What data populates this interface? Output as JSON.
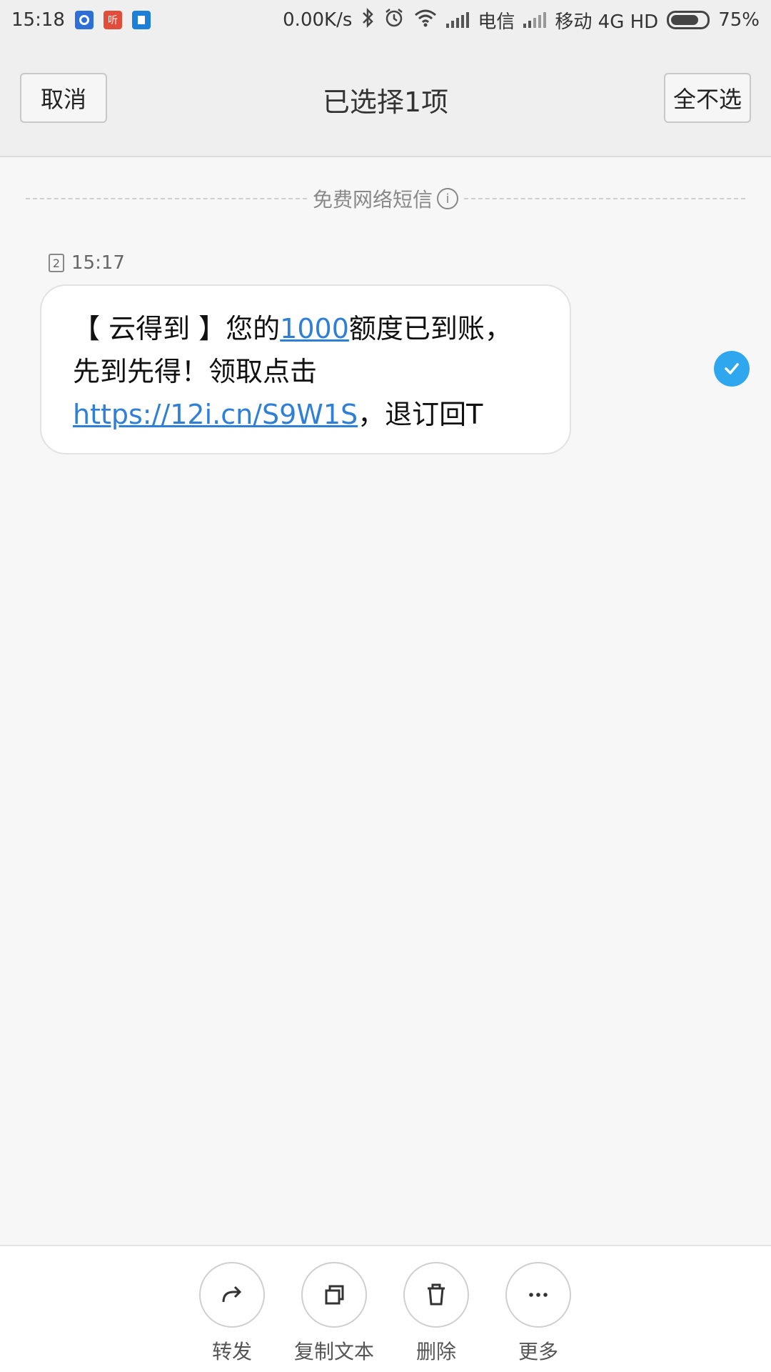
{
  "status_bar": {
    "time": "15:18",
    "notification_icons": [
      "du-app-icon",
      "listen-app-icon",
      "doc-app-icon"
    ],
    "mini_icon_text": {
      "listen": "听"
    },
    "net_speed": "0.00K/s",
    "carrier1": "电信",
    "carrier2": "移动 4G HD",
    "battery": "75%"
  },
  "header": {
    "cancel_label": "取消",
    "title": "已选择1项",
    "deselect_label": "全不选"
  },
  "divider": {
    "label": "免费网络短信"
  },
  "message": {
    "sim": "2",
    "time": "15:17",
    "text_part1": "【 云得到 】您的",
    "amount": "1000",
    "text_part2": "额度已到账，先到先得！领取点击 ",
    "link": "https://12i.cn/S9W1S",
    "text_part3": "，退订回T",
    "selected": true
  },
  "actions": [
    {
      "label": "转发",
      "icon": "forward-icon"
    },
    {
      "label": "复制文本",
      "icon": "copy-icon"
    },
    {
      "label": "删除",
      "icon": "trash-icon"
    },
    {
      "label": "更多",
      "icon": "more-icon"
    }
  ],
  "colors": {
    "accent": "#2fa7ee",
    "link": "#2f7fd6",
    "background": "#f7f7f7"
  }
}
